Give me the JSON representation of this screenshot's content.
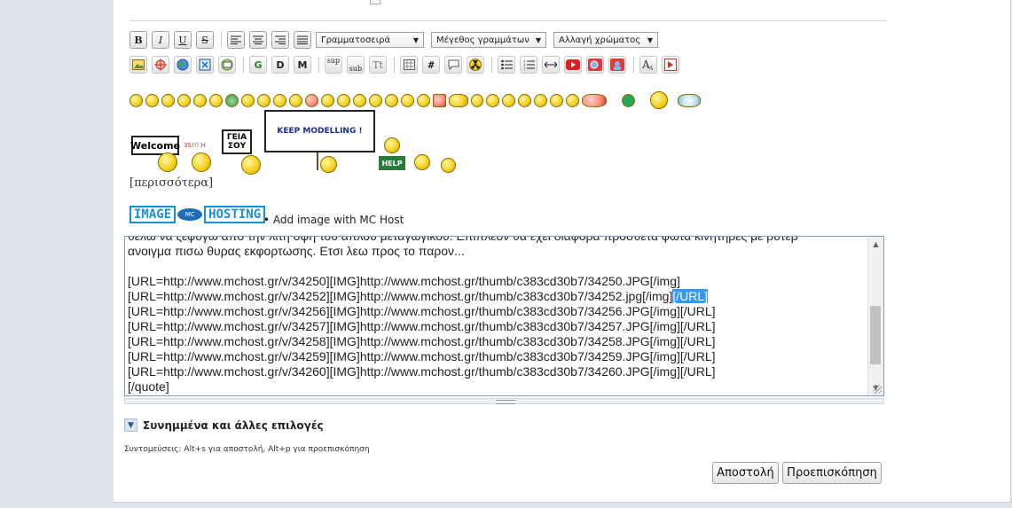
{
  "toolbar": {
    "font_select": "Γραμματοσειρά",
    "size_select": "Μέγεθος γραμμάτων",
    "color_select": "Αλλαγή χρώματος",
    "bold": "B",
    "italic": "I",
    "underline": "U",
    "strike": "S",
    "g": "G",
    "d": "D",
    "m": "M",
    "sup": "sup",
    "sub": "sub",
    "tt": "Tt",
    "hash": "#"
  },
  "signs": {
    "welcome": "Welcome",
    "geia_1": "ΓΕΙΑ",
    "geia_2": "ΣΟΥ",
    "keep": "KEEP MODELLING !",
    "help": "HELP",
    "small": "ЗS!!! Н"
  },
  "more_link": "[περισσότερα]",
  "image_hosting": {
    "logo_text_left": "IMAGE",
    "logo_disc": "MC",
    "logo_text_right": "HOSTING",
    "add_label": "• Add image with MC Host"
  },
  "editor": {
    "lines": [
      "θελω να ξεφυγω από την λιτη οψη του απλου μεταγωγικού. Επιπλεον θα εχει διαφορα προσθετα φωτα κινητηρες με ρυτερ",
      "ανοιγμα πισω θυρας εκφορτωσης. Ετσι λεω προς το παρον...",
      "",
      "[URL=http://www.mchost.gr/v/34250][IMG]http://www.mchost.gr/thumb/c383cd30b7/34250.JPG[/img]",
      "[URL=http://www.mchost.gr/v/34252][IMG]http://www.mchost.gr/thumb/c383cd30b7/34252.jpg[/img]",
      "[URL=http://www.mchost.gr/v/34256][IMG]http://www.mchost.gr/thumb/c383cd30b7/34256.JPG[/img][/URL]",
      "[URL=http://www.mchost.gr/v/34257][IMG]http://www.mchost.gr/thumb/c383cd30b7/34257.JPG[/img][/URL]",
      "[URL=http://www.mchost.gr/v/34258][IMG]http://www.mchost.gr/thumb/c383cd30b7/34258.JPG[/img][/URL]",
      "[URL=http://www.mchost.gr/v/34259][IMG]http://www.mchost.gr/thumb/c383cd30b7/34259.JPG[/img][/URL]",
      "[URL=http://www.mchost.gr/v/34260][IMG]http://www.mchost.gr/thumb/c383cd30b7/34260.JPG[/img][/URL]",
      "[/quote]"
    ],
    "selected_text": "[/URL]"
  },
  "attachments_label": "Συνημμένα και άλλες επιλογές",
  "shortcuts_text": "Συντομεύσεις: Alt+s για αποστολή, Alt+p για προεπισκόπηση",
  "buttons": {
    "submit": "Αποστολή",
    "preview": "Προεπισκόπηση"
  },
  "colors": {
    "page_bg": "#dde3ea",
    "selection": "#3399ff",
    "logo_blue": "#1c8fd0"
  }
}
